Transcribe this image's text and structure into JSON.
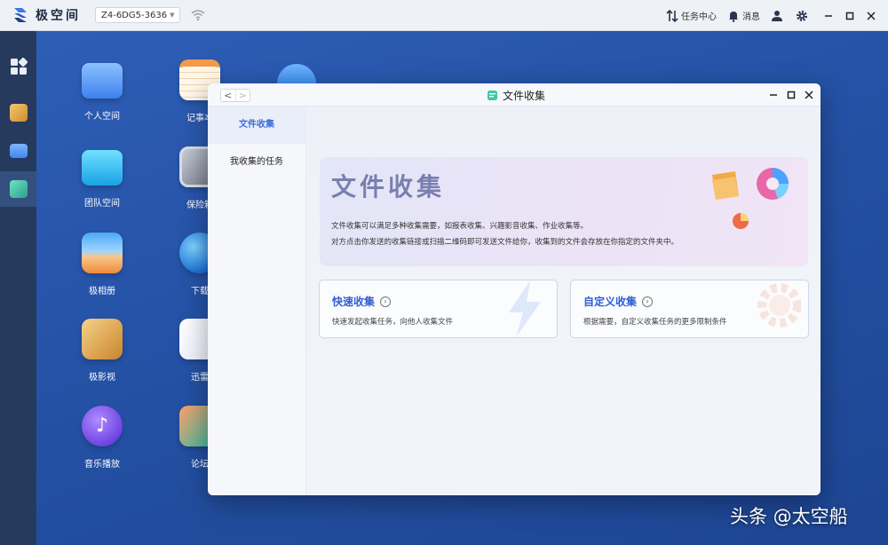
{
  "topbar": {
    "app_title": "极空间",
    "device_name": "Z4-6DG5-3636",
    "task_center": "任务中心",
    "messages": "消息",
    "icons": [
      "logo-icon",
      "wifi-icon",
      "task-center-icon",
      "bell-icon",
      "user-icon",
      "gear-icon",
      "minimize-icon",
      "maximize-icon",
      "close-icon"
    ]
  },
  "dock": {
    "items": [
      "apps-grid-icon",
      "video-icon",
      "folder-icon",
      "file-collect-icon"
    ]
  },
  "desktop": {
    "icons": [
      {
        "label": "个人空间",
        "icon": "folder-icon"
      },
      {
        "label": "记事本",
        "icon": "notepad-icon"
      },
      {
        "label": "团队空间",
        "icon": "team-folder-icon"
      },
      {
        "label": "保险箱",
        "icon": "safe-icon"
      },
      {
        "label": "极相册",
        "icon": "album-icon"
      },
      {
        "label": "下载",
        "icon": "globe-icon"
      },
      {
        "label": "极影视",
        "icon": "video-icon"
      },
      {
        "label": "迅雷",
        "icon": "xunlei-icon"
      },
      {
        "label": "音乐播放",
        "icon": "music-icon"
      },
      {
        "label": "论坛",
        "icon": "forum-icon"
      }
    ]
  },
  "window": {
    "title": "文件收集",
    "nav_back": "<",
    "nav_forward": ">",
    "sidebar": [
      {
        "label": "文件收集",
        "active": true
      },
      {
        "label": "我收集的任务",
        "active": false
      }
    ],
    "banner": {
      "title": "文件收集",
      "line1": "文件收集可以满足多种收集需要，如报表收集、兴趣影音收集、作业收集等。",
      "line2": "对方点击你发送的收集链接或扫描二维码即可发送文件给你，收集到的文件会存放在你指定的文件夹中。"
    },
    "cards": [
      {
        "title": "快速收集",
        "desc": "快速发起收集任务，向他人收集文件"
      },
      {
        "title": "自定义收集",
        "desc": "根据需要，自定义收集任务的更多限制条件"
      }
    ]
  },
  "watermark": "头条 @太空船",
  "colors": {
    "accent": "#2e5fd3",
    "desktop_bg": "#2552a6",
    "dock_bg": "#263a5e"
  }
}
